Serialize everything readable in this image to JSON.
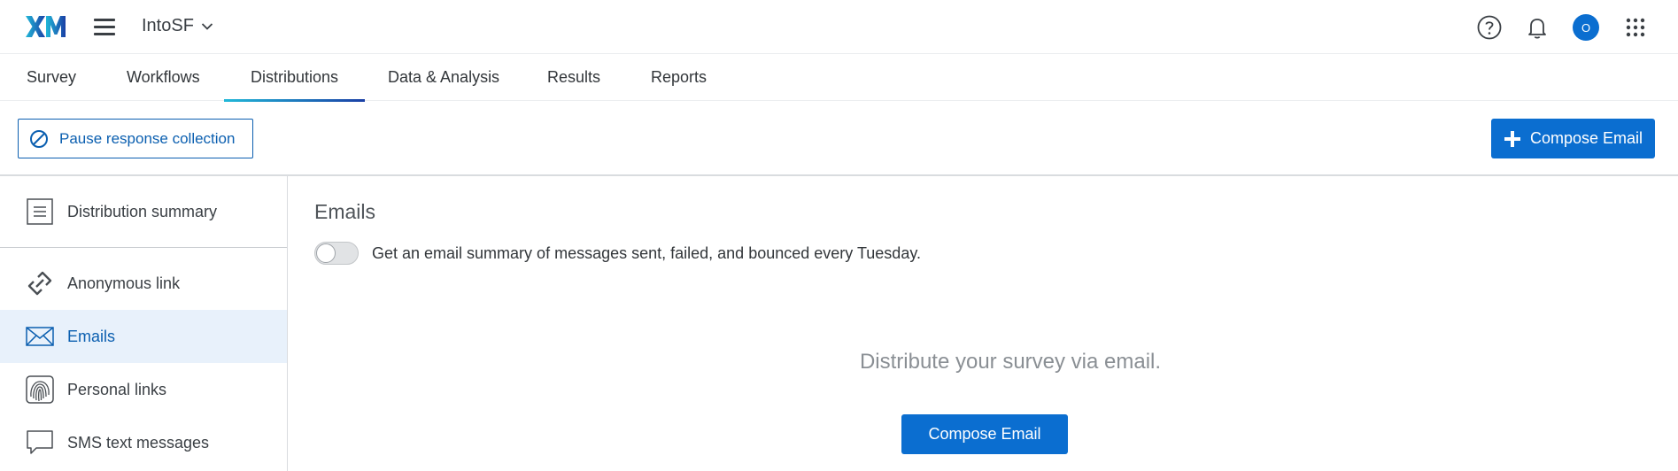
{
  "header": {
    "logo_text": "XM",
    "project_name": "IntoSF",
    "avatar_initial": "O",
    "icons": [
      "hamburger-icon",
      "chevron-down-icon",
      "help-icon",
      "bell-icon",
      "apps-grid-icon"
    ]
  },
  "tabs": [
    {
      "label": "Survey",
      "active": false
    },
    {
      "label": "Workflows",
      "active": false
    },
    {
      "label": "Distributions",
      "active": true
    },
    {
      "label": "Data & Analysis",
      "active": false
    },
    {
      "label": "Results",
      "active": false
    },
    {
      "label": "Reports",
      "active": false
    }
  ],
  "toolbar": {
    "pause_label": "Pause response collection",
    "compose_label": "Compose Email"
  },
  "sidebar": {
    "items": [
      {
        "label": "Distribution summary",
        "icon": "summary-list-icon",
        "active": false
      },
      {
        "label": "Anonymous link",
        "icon": "link-icon",
        "active": false
      },
      {
        "label": "Emails",
        "icon": "envelope-icon",
        "active": true
      },
      {
        "label": "Personal links",
        "icon": "fingerprint-icon",
        "active": false
      },
      {
        "label": "SMS text messages",
        "icon": "speech-bubble-icon",
        "active": false
      }
    ]
  },
  "main": {
    "title": "Emails",
    "toggle_on": false,
    "toggle_text": "Get an email summary of messages sent, failed, and bounced every Tuesday.",
    "empty_text": "Distribute your survey via email.",
    "compose_label": "Compose Email"
  },
  "colors": {
    "primary": "#0b6ed0",
    "primary_dark": "#0b5fb0",
    "active_bg": "#e8f1fb",
    "tab_gradient_start": "#21b8d8",
    "tab_gradient_end": "#1a3fa5"
  }
}
